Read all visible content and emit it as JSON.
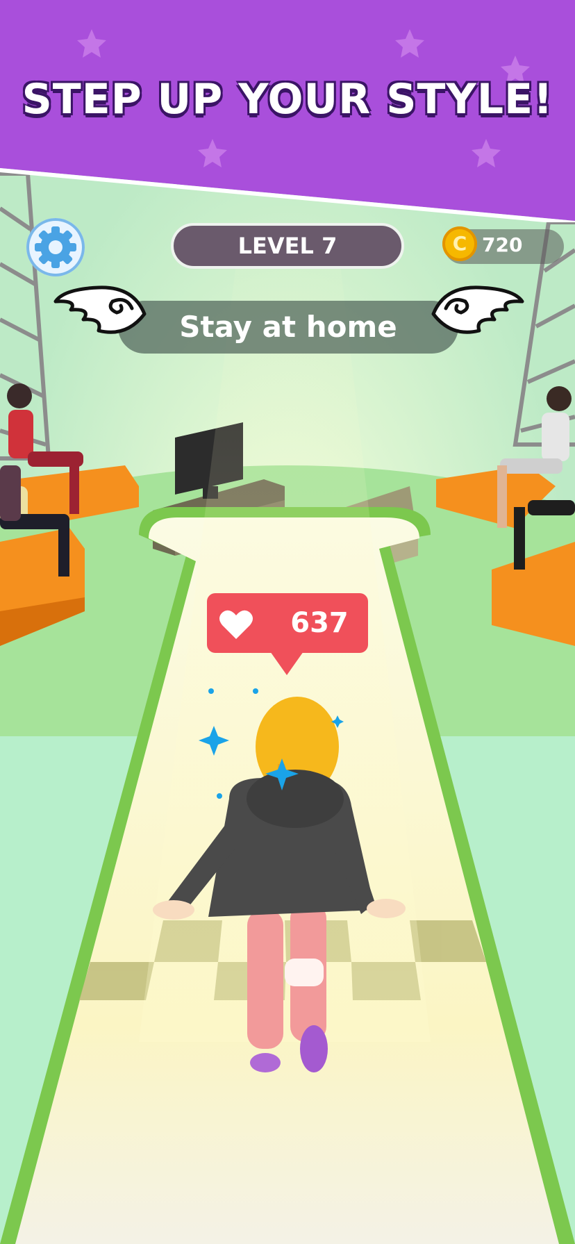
{
  "banner": {
    "title": "STEP UP YOUR STYLE!"
  },
  "hud": {
    "settings_icon": "gear-icon",
    "level_label": "LEVEL 7",
    "coins": "720",
    "coin_symbol": "C",
    "coin_icon": "coin-icon"
  },
  "mission": {
    "label": "Stay at home",
    "wing_icon": "angel-wing-icon"
  },
  "likes": {
    "count": "637",
    "icon": "heart-icon"
  },
  "colors": {
    "banner_purple": "#a94fdb",
    "runway_green": "#7cc84e",
    "like_red": "#f0505a",
    "seat_orange": "#f5901e",
    "coin_gold": "#f6b800"
  }
}
